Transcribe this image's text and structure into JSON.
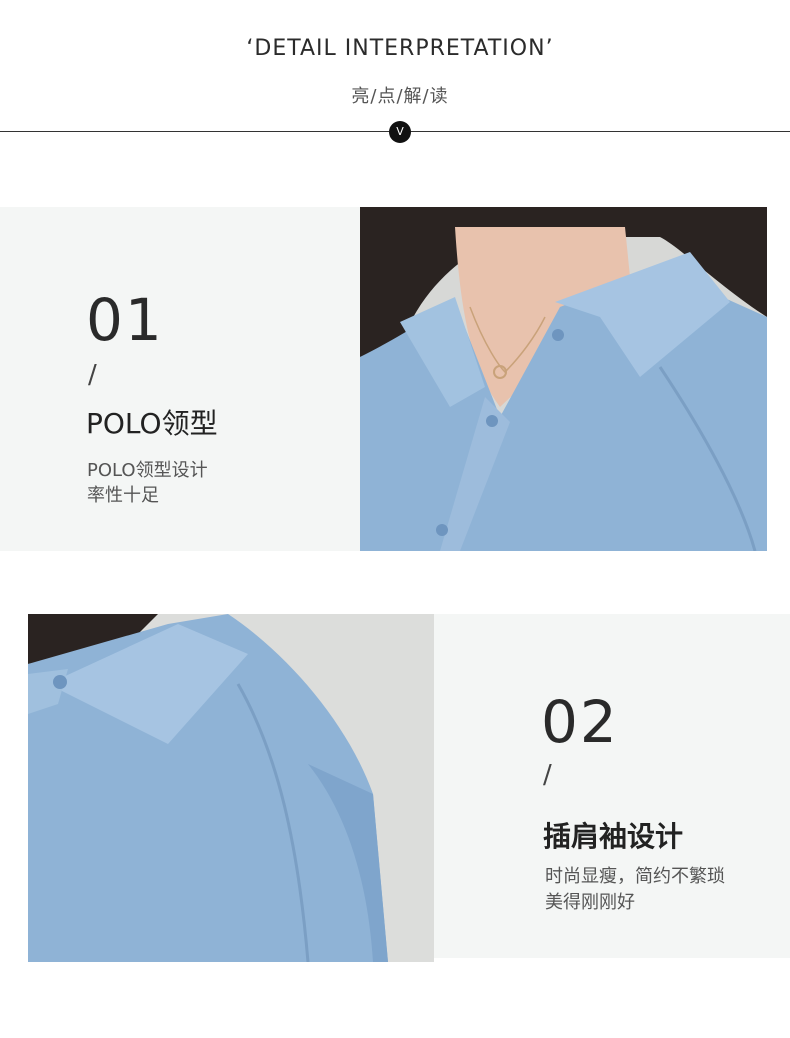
{
  "header": {
    "title_en": "‘DETAIL INTERPRETATION’",
    "title_cn": "亮/点/解/读",
    "badge": "V"
  },
  "features": [
    {
      "number": "01",
      "slash": "/",
      "title": "POLO领型",
      "desc_line1": "POLO领型设计",
      "desc_line2": "率性十足"
    },
    {
      "number": "02",
      "slash": "/",
      "title": "插肩袖设计",
      "desc_line1": "时尚显瘦，简约不繁琐",
      "desc_line2": "美得刚刚好"
    }
  ],
  "colors": {
    "shirt_blue": "#8fb3d6",
    "panel_bg": "#f4f6f5"
  }
}
